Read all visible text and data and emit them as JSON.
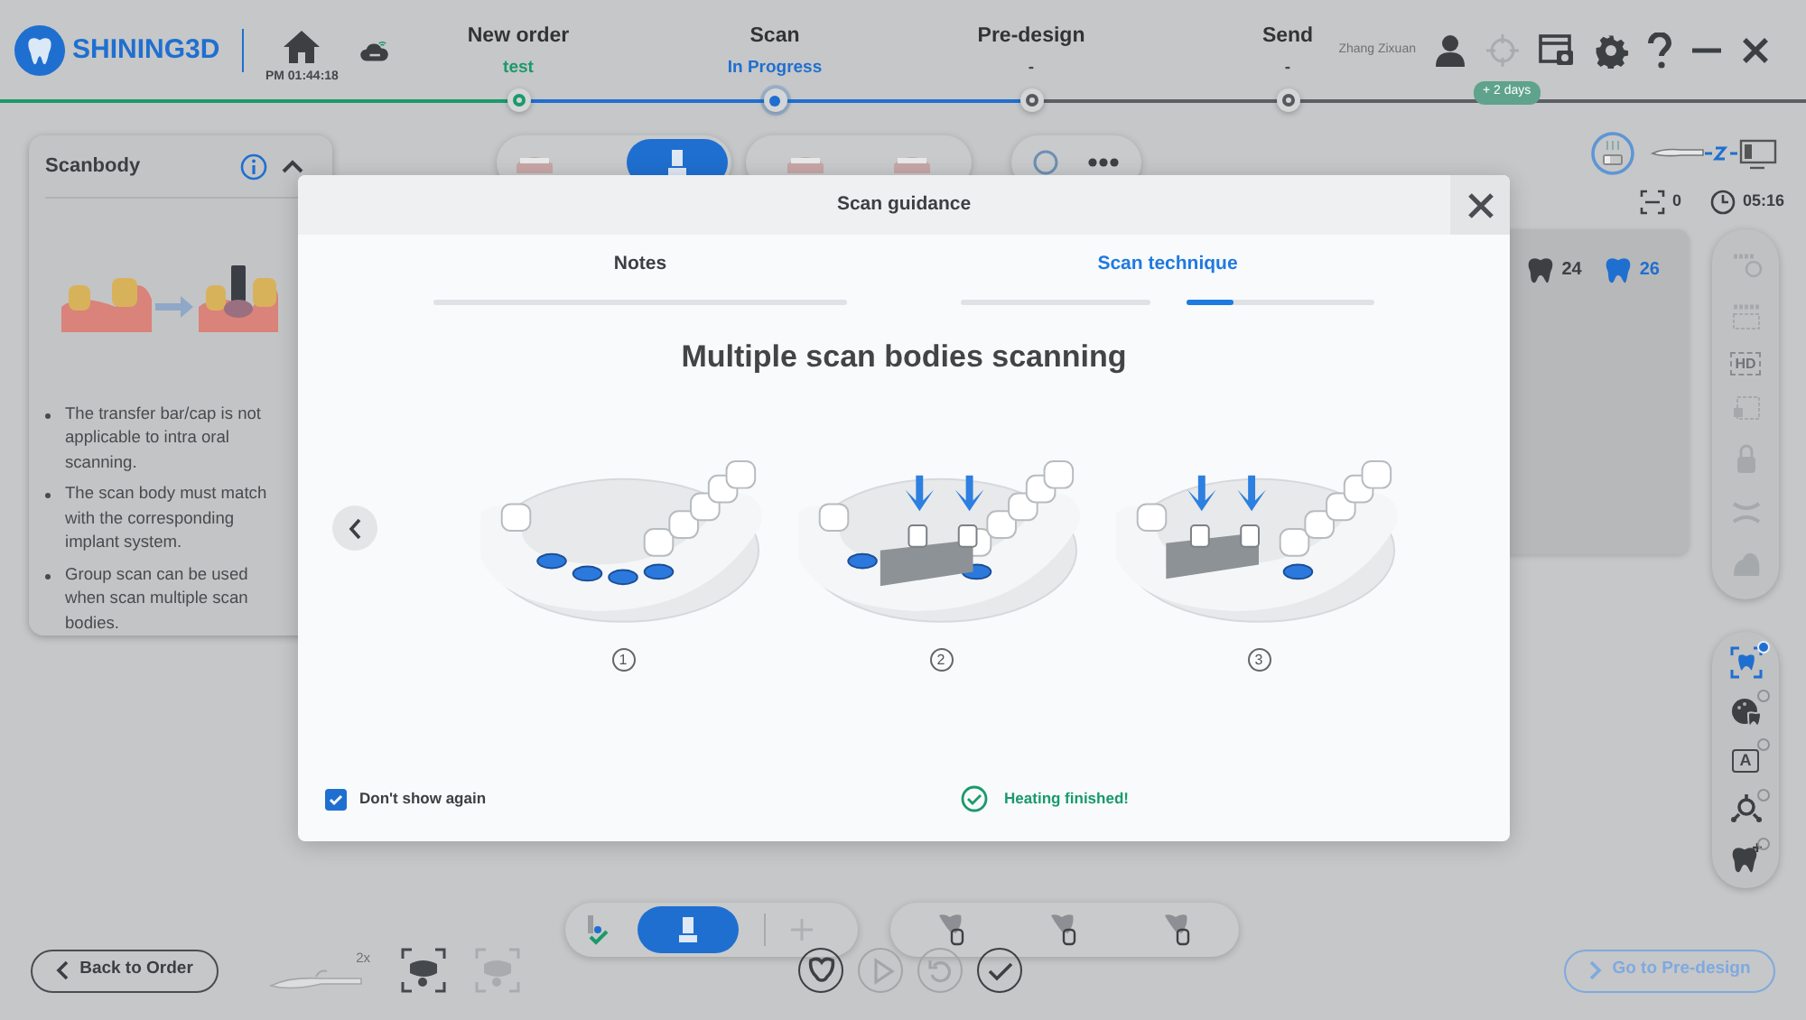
{
  "header": {
    "brand": "SHINING3D",
    "time": "PM 01:44:18",
    "user": "Zhang Zixuan",
    "badge": "+ 2 days"
  },
  "steps": [
    {
      "label": "New order",
      "status": "test",
      "completed": true,
      "selected": false
    },
    {
      "label": "Scan",
      "status": "In Progress",
      "completed": false,
      "selected": true
    },
    {
      "label": "Pre-design",
      "status": "-",
      "completed": false,
      "selected": false
    },
    {
      "label": "Send",
      "status": "-",
      "completed": false,
      "selected": false
    }
  ],
  "scanbody_panel": {
    "title": "Scanbody",
    "expanded": true,
    "notes": [
      "The transfer bar/cap is not applicable to intra oral scanning.",
      "The scan body must match with the corresponding implant system.",
      "Group scan can be used when scan multiple scan bodies."
    ]
  },
  "scan_status": {
    "count": "0",
    "timer": "05:16"
  },
  "teeth": [
    {
      "number": "24",
      "selected": false
    },
    {
      "number": "26",
      "selected": true
    }
  ],
  "tool_strip": [
    {
      "kind": "scan-settings"
    },
    {
      "kind": "crop"
    },
    {
      "kind": "hd",
      "label": "HD"
    },
    {
      "kind": "trim"
    },
    {
      "kind": "lock"
    },
    {
      "kind": "bite"
    },
    {
      "kind": "model"
    }
  ],
  "view_tools": [
    {
      "kind": "tooth-scan",
      "selected": true
    },
    {
      "kind": "color",
      "selected": false
    },
    {
      "kind": "text-mark",
      "label": "A",
      "selected": false
    },
    {
      "kind": "align",
      "selected": false
    },
    {
      "kind": "tooth-edit",
      "selected": false
    }
  ],
  "playback": [
    {
      "kind": "logo",
      "disabled": false
    },
    {
      "kind": "play",
      "disabled": true
    },
    {
      "kind": "undo",
      "disabled": true
    },
    {
      "kind": "confirm",
      "disabled": false
    }
  ],
  "footer": {
    "back": "Back to Order",
    "scanner_label": "2x",
    "next": {
      "label": "Go to Pre-design",
      "disabled": true
    }
  },
  "modal": {
    "title": "Scan guidance",
    "tabs": [
      {
        "label": "Notes",
        "selected": false,
        "pages": [
          {
            "selected": false
          }
        ]
      },
      {
        "label": "Scan technique",
        "selected": true,
        "pages": [
          {
            "selected": false
          },
          {
            "selected": true,
            "level": 0.25
          }
        ]
      }
    ],
    "heading": "Multiple scan bodies scanning",
    "steps": [
      {
        "number": "1"
      },
      {
        "number": "2"
      },
      {
        "number": "3"
      }
    ],
    "dont_show_again": {
      "label": "Don't show again",
      "checked": true
    },
    "status": {
      "text": "Heating finished!",
      "kind": "success"
    }
  }
}
